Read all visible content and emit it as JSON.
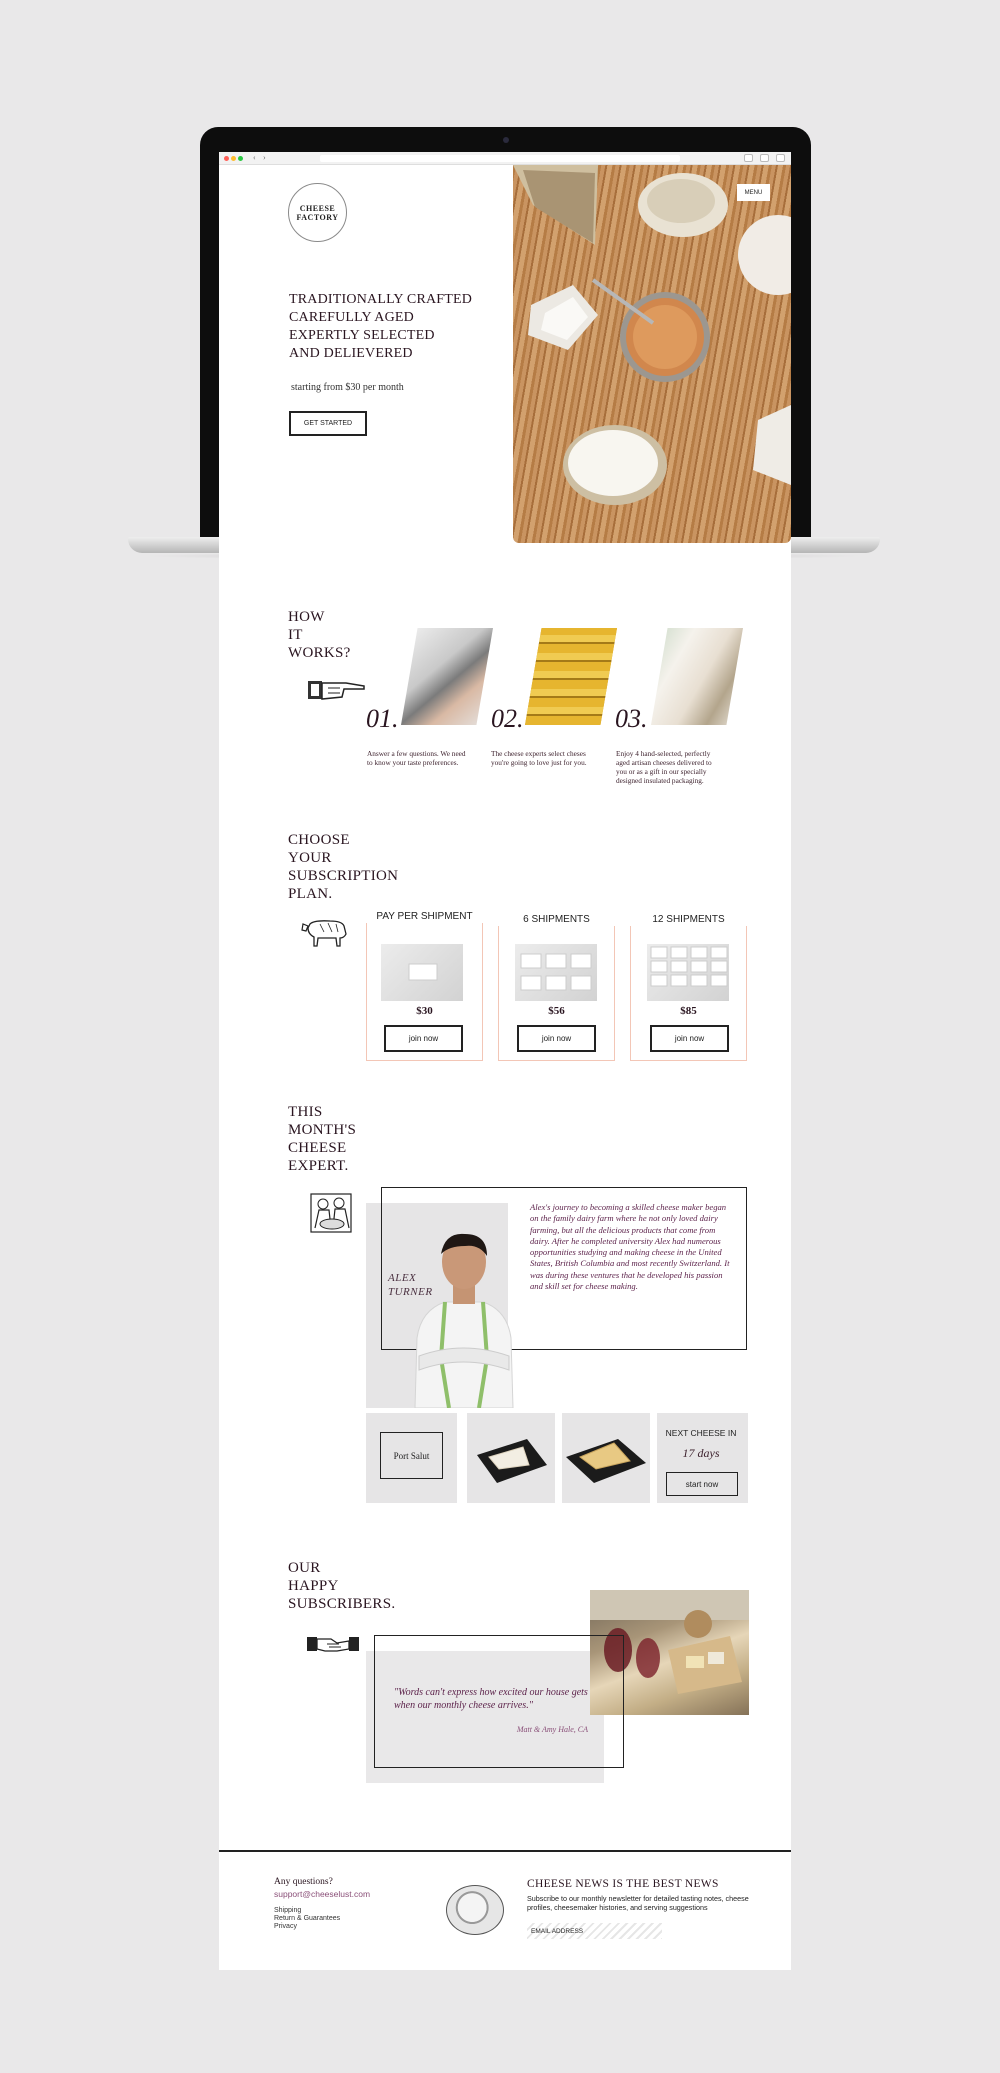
{
  "hero": {
    "logo_text": "CHEESE FACTORY",
    "menu_label": "MENU",
    "headline": [
      "TRADITIONALLY CRAFTED",
      "CAREFULLY AGED",
      "EXPERTLY SELECTED",
      "AND DELIEVERED"
    ],
    "price_line": "starting from $30 per month",
    "cta_label": "GET STARTED"
  },
  "how": {
    "heading": [
      "HOW",
      "IT",
      "WORKS?"
    ],
    "steps": [
      {
        "num": "01.",
        "text": "Answer a few questions. We need to know your taste preferences."
      },
      {
        "num": "02.",
        "text": "The cheese experts select cheses you're going to love just for you."
      },
      {
        "num": "03.",
        "text": "Enjoy 4 hand-selected, perfectly aged artisan cheeses delivered to you or as a gift in our specially designed insulated packaging."
      }
    ]
  },
  "plans": {
    "heading": [
      "CHOOSE",
      "YOUR",
      "SUBSCRIPTION",
      "PLAN."
    ],
    "items": [
      {
        "title": "PAY PER SHIPMENT",
        "price": "$30",
        "button": "join now"
      },
      {
        "title": "6 SHIPMENTS",
        "price": "$56",
        "button": "join now"
      },
      {
        "title": "12 SHIPMENTS",
        "price": "$85",
        "button": "join now"
      }
    ]
  },
  "expert": {
    "heading": [
      "THIS",
      "MONTH'S",
      "CHEESE",
      "EXPERT."
    ],
    "name": [
      "ALEX",
      "TURNER"
    ],
    "bio": "Alex's journey to becoming a skilled cheese maker began on the family dairy farm where he not only loved dairy farming, but all the delicious products that come from dairy. After he completed university Alex had numerous opportunities studying and making cheese in the United States, British Columbia and most recently Switzerland. It was during these ventures that he developed his passion and skill set for cheese making.",
    "featured_cheese": "Port Salut",
    "next_label": "NEXT CHEESE IN",
    "next_days": "17 days",
    "start_label": "start now"
  },
  "subscribers": {
    "heading": [
      "OUR",
      "HAPPY",
      "SUBSCRIBERS."
    ],
    "quote": "\"Words can't express how excited our house gets when our monthly cheese arrives.\"",
    "author": "Matt & Amy Hale, CA"
  },
  "footer": {
    "question": "Any questions?",
    "email": "support@cheeselust.com",
    "links": [
      "Shipping",
      "Return & Guarantees",
      "Privacy"
    ],
    "news_heading": "CHEESE NEWS IS THE BEST NEWS",
    "news_sub": "Subscribe to our monthly newsletter for detailed tasting notes, cheese profiles, cheesemaker histories, and serving suggestions",
    "email_placeholder": "EMAIL ADDRESS"
  },
  "icons": [
    "pointing-hand-icon",
    "cow-icon",
    "cheesemaker-engraving-icon",
    "handshake-icon",
    "cheese-badge-icon"
  ],
  "colors": {
    "accent_plum": "#5a1f48",
    "plan_border": "#f3c6b6",
    "background": "#e9e8e9"
  }
}
